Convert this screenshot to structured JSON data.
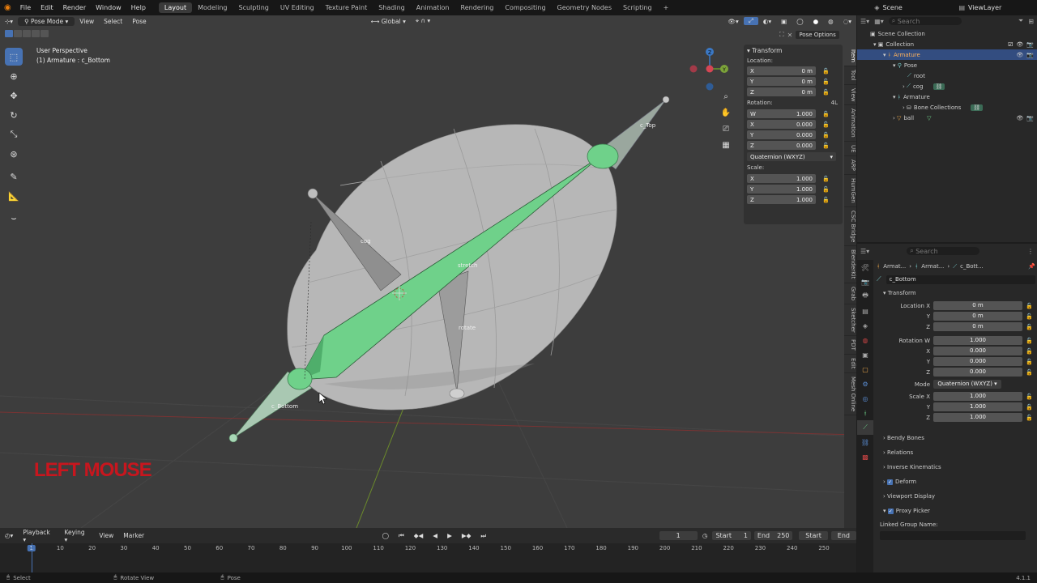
{
  "menu": {
    "blender_logo": "blender-icon",
    "items": [
      "File",
      "Edit",
      "Render",
      "Window",
      "Help"
    ]
  },
  "workspaces": [
    "Layout",
    "Modeling",
    "Sculpting",
    "UV Editing",
    "Texture Paint",
    "Shading",
    "Animation",
    "Rendering",
    "Compositing",
    "Geometry Nodes",
    "Scripting"
  ],
  "workspace_add": "+",
  "scene": {
    "name": "Scene",
    "view_layer": "ViewLayer"
  },
  "viewport": {
    "mode": "Pose Mode",
    "menus": [
      "View",
      "Select",
      "Pose"
    ],
    "orientation": "Global",
    "perspective": "User Perspective",
    "active": "(1) Armature : c_Bottom",
    "pose_options": "Pose Options",
    "bone_labels": {
      "c_top": "c_Top",
      "cog": "cog",
      "stretch": "stretch",
      "rotate": "rotate",
      "c_bottom": "c_Bottom"
    },
    "overlay_text": "LEFT MOUSE",
    "axis": {
      "x": "X",
      "y": "Y",
      "z": "Z"
    }
  },
  "npanel": {
    "title": "Transform",
    "location_label": "Location:",
    "location": [
      {
        "axis": "X",
        "value": "0 m"
      },
      {
        "axis": "Y",
        "value": "0 m"
      },
      {
        "axis": "Z",
        "value": "0 m"
      }
    ],
    "rotation_label": "Rotation:",
    "rotation_mode_short": "4L",
    "rotation": [
      {
        "axis": "W",
        "value": "1.000"
      },
      {
        "axis": "X",
        "value": "0.000"
      },
      {
        "axis": "Y",
        "value": "0.000"
      },
      {
        "axis": "Z",
        "value": "0.000"
      }
    ],
    "rotation_mode": "Quaternion (WXYZ)",
    "scale_label": "Scale:",
    "scale": [
      {
        "axis": "X",
        "value": "1.000"
      },
      {
        "axis": "Y",
        "value": "1.000"
      },
      {
        "axis": "Z",
        "value": "1.000"
      }
    ],
    "tabs": [
      "Item",
      "Tool",
      "View",
      "Animation",
      "UE",
      "ARP",
      "HumGen",
      "CSC Bridge",
      "BlenderKit",
      "Grab",
      "Sketcher",
      "PDT",
      "Edit",
      "Mesh Online"
    ]
  },
  "timeline": {
    "menus": [
      "Playback",
      "Keying",
      "View",
      "Marker"
    ],
    "current_frame": "1",
    "start_label": "Start",
    "start": "1",
    "end_label": "End",
    "end": "250",
    "btn_start": "Start",
    "btn_end": "End",
    "ticks": [
      "1",
      "10",
      "20",
      "30",
      "40",
      "50",
      "60",
      "70",
      "80",
      "90",
      "100",
      "110",
      "120",
      "130",
      "140",
      "150",
      "160",
      "170",
      "180",
      "190",
      "200",
      "210",
      "220",
      "230",
      "240",
      "250"
    ]
  },
  "status": {
    "select": "Select",
    "rotate": "Rotate View",
    "pose": "Pose",
    "version": "4.1.1"
  },
  "outliner": {
    "search_placeholder": "Search",
    "rows": [
      {
        "label": "Scene Collection"
      },
      {
        "label": "Collection"
      },
      {
        "label": "Armature"
      },
      {
        "label": "Pose"
      },
      {
        "label": "root"
      },
      {
        "label": "cog"
      },
      {
        "label": "Armature"
      },
      {
        "label": "Bone Collections"
      },
      {
        "label": "ball"
      }
    ]
  },
  "properties": {
    "search_placeholder": "Search",
    "breadcrumb": [
      "Armat...",
      "Armat...",
      "c_Bott..."
    ],
    "bone_name": "c_Bottom",
    "transform_title": "Transform",
    "fields": [
      {
        "label": "Location X",
        "value": "0 m"
      },
      {
        "label": "Y",
        "value": "0 m"
      },
      {
        "label": "Z",
        "value": "0 m"
      },
      {
        "label": "Rotation W",
        "value": "1.000"
      },
      {
        "label": "X",
        "value": "0.000"
      },
      {
        "label": "Y",
        "value": "0.000"
      },
      {
        "label": "Z",
        "value": "0.000"
      }
    ],
    "mode_label": "Mode",
    "mode_value": "Quaternion (WXYZ)",
    "scale_fields": [
      {
        "label": "Scale X",
        "value": "1.000"
      },
      {
        "label": "Y",
        "value": "1.000"
      },
      {
        "label": "Z",
        "value": "1.000"
      }
    ],
    "sections": [
      {
        "label": "Bendy Bones",
        "checkbox": false
      },
      {
        "label": "Relations",
        "checkbox": false
      },
      {
        "label": "Inverse Kinematics",
        "checkbox": false
      },
      {
        "label": "Deform",
        "checkbox": true
      },
      {
        "label": "Viewport Display",
        "checkbox": false
      },
      {
        "label": "Proxy Picker",
        "checkbox": true
      }
    ],
    "linked_group_label": "Linked Group Name:"
  },
  "colors": {
    "accent": "#4772b3",
    "bone_green": "#6fd18a",
    "overlay_red": "#c8161e",
    "selected_row": "#334d80"
  }
}
